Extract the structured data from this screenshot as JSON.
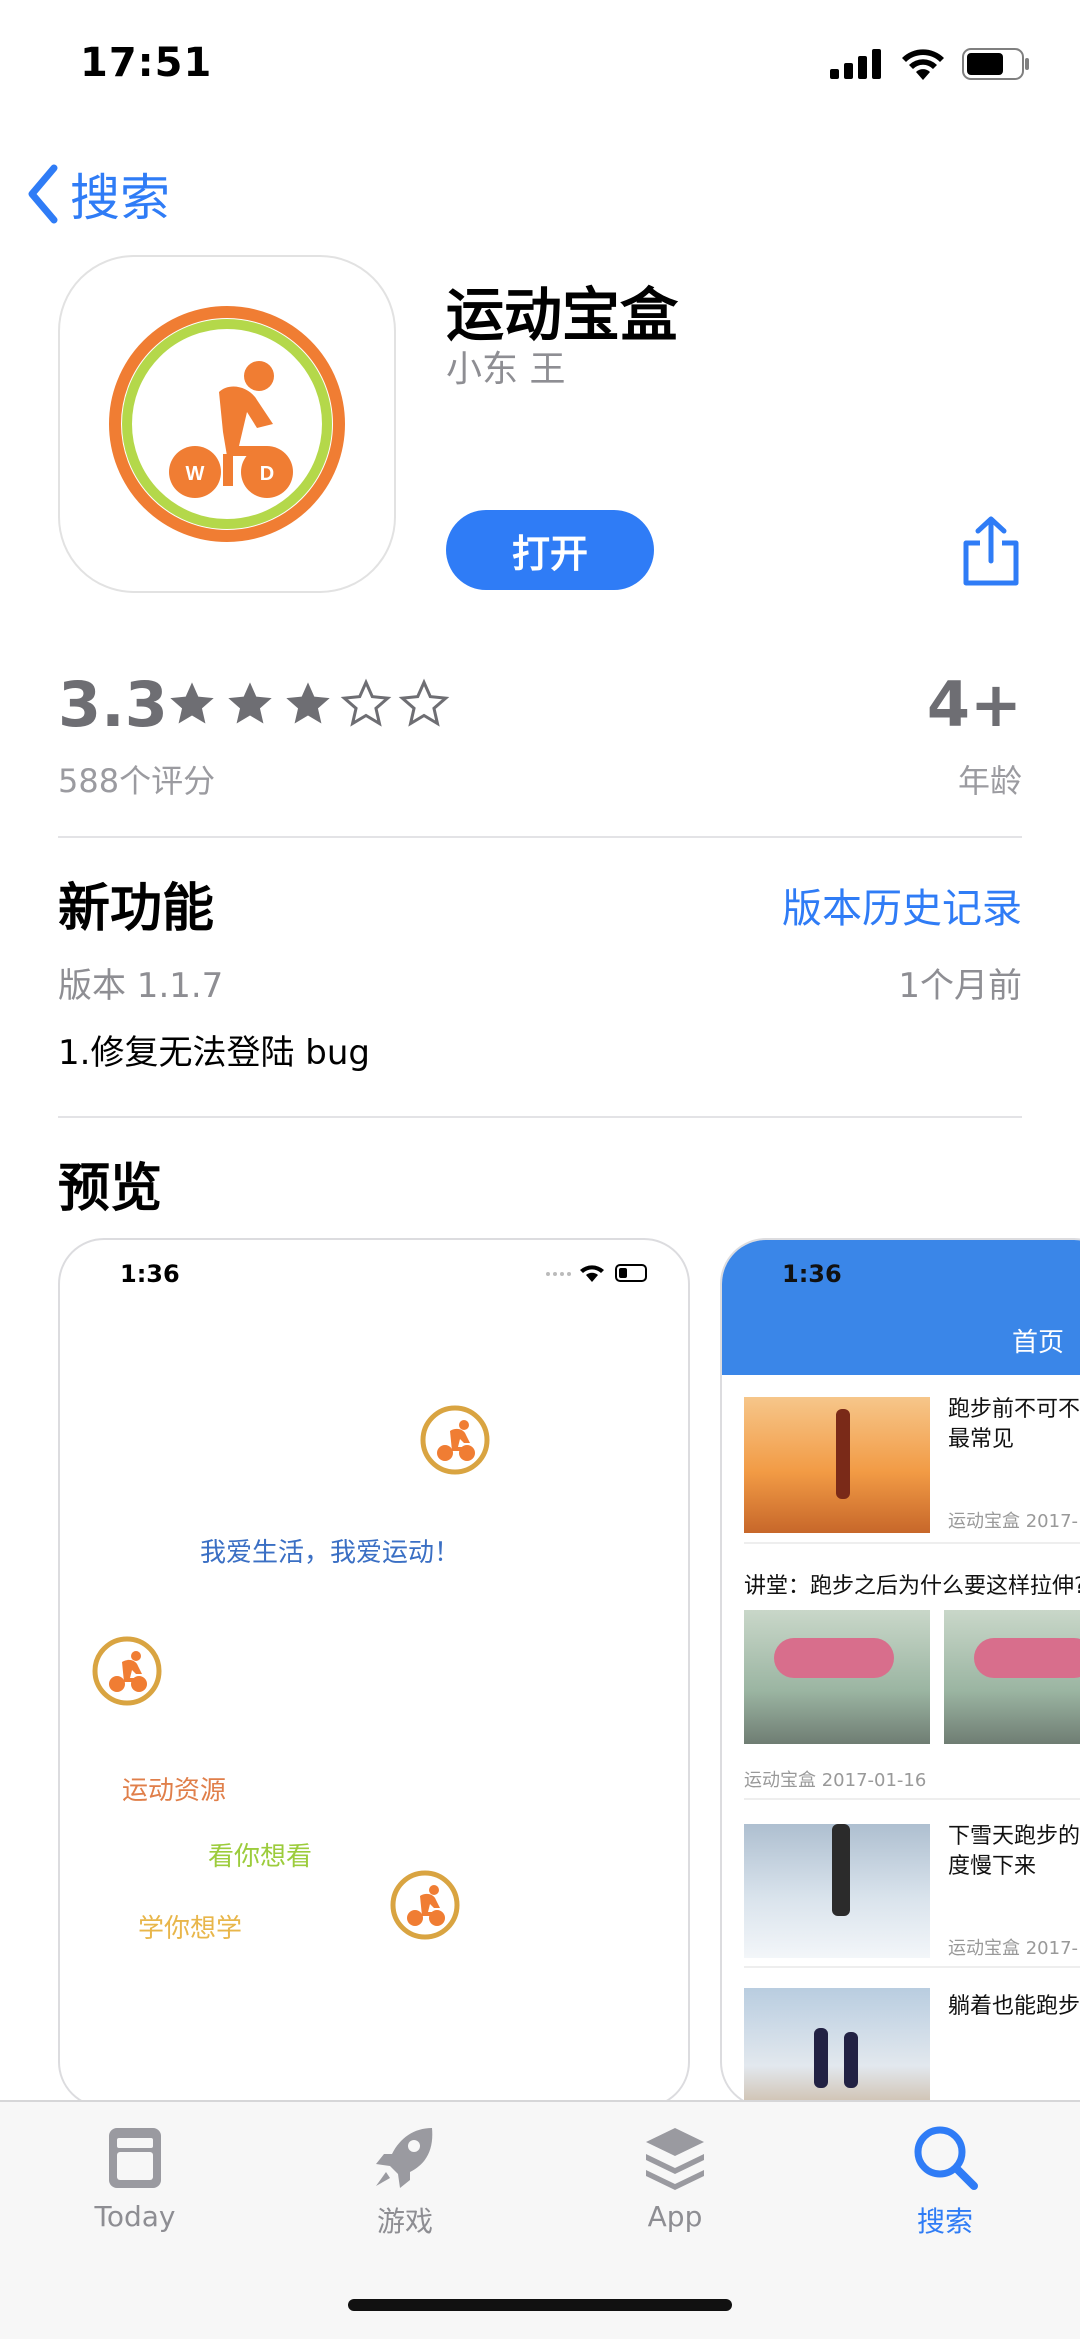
{
  "status_bar": {
    "time": "17:51"
  },
  "nav": {
    "back_label": "搜索"
  },
  "app": {
    "name": "运动宝盒",
    "developer": "小东 王",
    "open_label": "打开",
    "icon_letters": {
      "left": "W",
      "right": "D"
    }
  },
  "ratings": {
    "score": "3.3",
    "stars": 3,
    "max_stars": 5,
    "count_label": "588个评分",
    "age": "4+",
    "age_label": "年龄"
  },
  "whats_new": {
    "title": "新功能",
    "history_link": "版本历史记录",
    "version": "版本 1.1.7",
    "date": "1个月前",
    "notes": "1.修复无法登陆 bug"
  },
  "preview": {
    "title": "预览",
    "shot1": {
      "time": "1:36",
      "slogan": "我爱生活，我爱运动！",
      "menu": [
        "运动资源",
        "看你想看",
        "学你想学"
      ]
    },
    "shot2": {
      "time": "1:36",
      "header": "首页",
      "articles": [
        {
          "title": "跑步前不可不知 最常见",
          "meta": "运动宝盒  2017-"
        },
        {
          "title": "讲堂：跑步之后为什么要这样拉伸?",
          "meta": "运动宝盒  2017-01-16"
        },
        {
          "title": "下雪天跑步的人 度慢下来",
          "meta": "运动宝盒  2017-"
        },
        {
          "title": "躺着也能跑步",
          "meta": ""
        }
      ]
    }
  },
  "tab_bar": {
    "items": [
      {
        "label": "Today",
        "icon": "today-icon"
      },
      {
        "label": "游戏",
        "icon": "rocket-icon"
      },
      {
        "label": "App",
        "icon": "layers-icon"
      },
      {
        "label": "搜索",
        "icon": "search-icon"
      }
    ],
    "active": "搜索"
  },
  "colors": {
    "accent": "#2f7cf6",
    "brand_orange": "#f07d33",
    "brand_green": "#b4d84a"
  }
}
